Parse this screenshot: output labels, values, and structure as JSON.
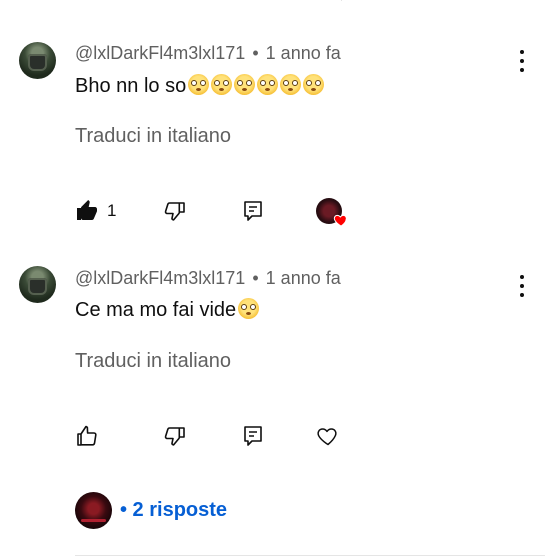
{
  "comments": [
    {
      "author": "@lxlDarkFl4m3lxl171",
      "separator": "•",
      "time": "1 anno fa",
      "text": "Bho nn lo so",
      "emoji_count": 6,
      "emoji_name": "flushed-face-emoji",
      "translate": "Traduci in italiano",
      "likes": "1",
      "liked": true,
      "creator_heart": true
    },
    {
      "author": "@lxlDarkFl4m3lxl171",
      "separator": "•",
      "time": "1 anno fa",
      "text": "Ce ma mo fai vide",
      "emoji_count": 1,
      "emoji_name": "flushed-face-emoji",
      "translate": "Traduci in italiano",
      "likes": "",
      "liked": false,
      "creator_heart": false
    }
  ],
  "replies": {
    "label": "• 2 risposte"
  },
  "colors": {
    "link": "#065fd4",
    "secondary_text": "#606060",
    "heart": "#ff0000"
  },
  "icons": [
    "thumbs-up-icon",
    "thumbs-down-icon",
    "reply-icon",
    "heart-icon",
    "more-vert-icon"
  ]
}
